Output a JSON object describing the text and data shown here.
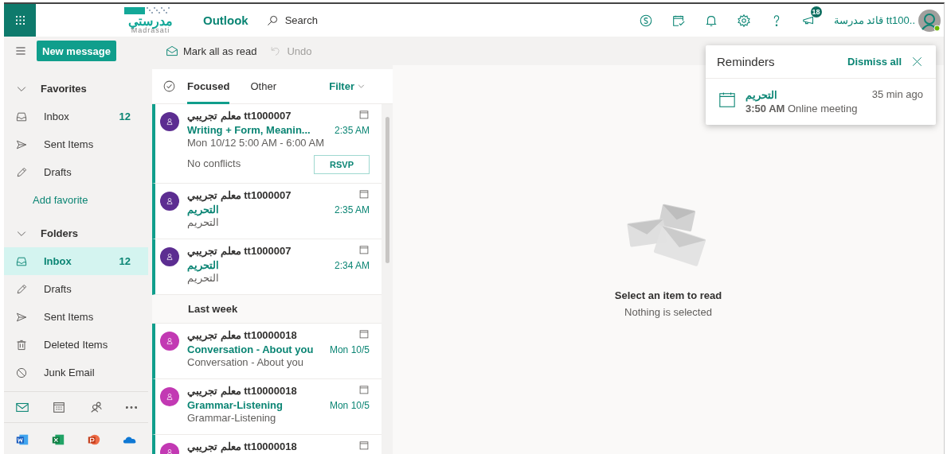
{
  "header": {
    "logo": {
      "arabic": "مدرستي",
      "latin": "Madrasati"
    },
    "app_name": "Outlook",
    "search_label": "Search",
    "notification_count": "18",
    "user_name": "قائد مدرسة tt100.."
  },
  "toolbar": {
    "new_message": "New message",
    "actions": [
      {
        "kind": "mark-read",
        "label": "Mark all as read",
        "disabled": false
      },
      {
        "kind": "undo",
        "label": "Undo",
        "disabled": true
      }
    ]
  },
  "nav": {
    "sections": [
      {
        "title": "Favorites",
        "expanded": true,
        "items": [
          {
            "kind": "inbox",
            "label": "Inbox",
            "count": "12",
            "selected": false
          },
          {
            "kind": "sent",
            "label": "Sent Items",
            "selected": false
          },
          {
            "kind": "drafts",
            "label": "Drafts",
            "selected": false
          },
          {
            "kind": "add",
            "label": "Add favorite",
            "selected": false
          }
        ]
      },
      {
        "title": "Folders",
        "expanded": true,
        "items": [
          {
            "kind": "inbox",
            "label": "Inbox",
            "count": "12",
            "selected": true
          },
          {
            "kind": "drafts",
            "label": "Drafts",
            "selected": false
          },
          {
            "kind": "sent",
            "label": "Sent Items",
            "selected": false
          },
          {
            "kind": "deleted",
            "label": "Deleted Items",
            "selected": false
          },
          {
            "kind": "junk",
            "label": "Junk Email",
            "selected": false
          }
        ]
      }
    ],
    "modules": [
      {
        "kind": "mail",
        "selected": true
      },
      {
        "kind": "calendar",
        "selected": false
      },
      {
        "kind": "people",
        "selected": false
      },
      {
        "kind": "more",
        "selected": false
      }
    ],
    "apps": [
      {
        "kind": "word"
      },
      {
        "kind": "excel"
      },
      {
        "kind": "powerpoint"
      },
      {
        "kind": "onedrive"
      }
    ]
  },
  "message_list": {
    "tabs": [
      {
        "label": "Focused",
        "selected": true
      },
      {
        "label": "Other",
        "selected": false
      }
    ],
    "filter": "Filter",
    "items": [
      {
        "kind": "message",
        "sender": "معلم تجريبي tt1000007",
        "subject": "Writing + Form, Meanin...",
        "time": "2:35 AM",
        "color": "#5c2d91",
        "unread": true,
        "meeting": {
          "when": "Mon 10/12 5:00 AM - 6:00 AM",
          "conflicts": "No conflicts",
          "rsvp": "RSVP"
        }
      },
      {
        "kind": "message",
        "sender": "معلم تجريبي tt1000007",
        "subject": "التحريم",
        "time": "2:35 AM",
        "preview": "التحريم",
        "color": "#5c2d91",
        "unread": true
      },
      {
        "kind": "message",
        "sender": "معلم تجريبي tt1000007",
        "subject": "التحريم",
        "time": "2:34 AM",
        "preview": "التحريم",
        "color": "#5c2d91",
        "unread": true
      },
      {
        "kind": "header",
        "label": "Last week"
      },
      {
        "kind": "message",
        "sender": "معلم تجريبي tt10000018",
        "subject": "Conversation - About you",
        "time": "Mon 10/5",
        "preview": "Conversation - About you",
        "color": "#c239b3",
        "unread": true
      },
      {
        "kind": "message",
        "sender": "معلم تجريبي tt10000018",
        "subject": "Grammar-Listening",
        "time": "Mon 10/5",
        "preview": "Grammar-Listening",
        "color": "#c239b3",
        "unread": true
      },
      {
        "kind": "message",
        "sender": "معلم تجريبي tt10000018",
        "color": "#c239b3",
        "unread": true
      }
    ]
  },
  "reading_pane": {
    "title": "Select an item to read",
    "subtitle": "Nothing is selected"
  },
  "reminders": {
    "title": "Reminders",
    "dismiss_all": "Dismiss all",
    "items": [
      {
        "subject": "التحريم",
        "time": "3:50 AM",
        "description": "Online meeting",
        "ago": "35 min ago"
      }
    ]
  }
}
